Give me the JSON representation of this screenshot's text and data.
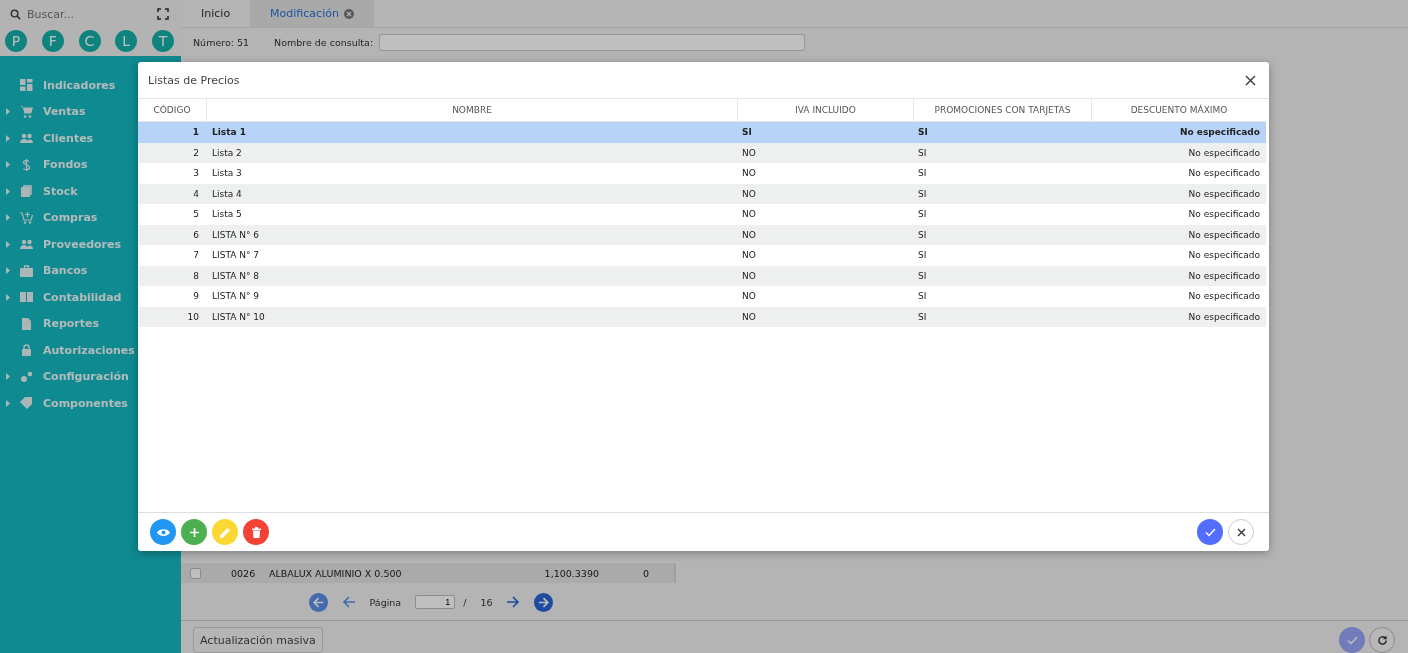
{
  "sidebar": {
    "search": {
      "placeholder": "Buscar..."
    },
    "shortcuts": [
      "P",
      "F",
      "C",
      "L",
      "T"
    ],
    "items": [
      {
        "label": "Indicadores",
        "expandable": false
      },
      {
        "label": "Ventas",
        "expandable": true
      },
      {
        "label": "Clientes",
        "expandable": true
      },
      {
        "label": "Fondos",
        "expandable": true
      },
      {
        "label": "Stock",
        "expandable": true
      },
      {
        "label": "Compras",
        "expandable": true
      },
      {
        "label": "Proveedores",
        "expandable": true
      },
      {
        "label": "Bancos",
        "expandable": true
      },
      {
        "label": "Contabilidad",
        "expandable": true
      },
      {
        "label": "Reportes",
        "expandable": false
      },
      {
        "label": "Autorizaciones",
        "expandable": false
      },
      {
        "label": "Configuración",
        "expandable": true
      },
      {
        "label": "Componentes",
        "expandable": true
      }
    ]
  },
  "tabs": [
    {
      "label": "Inicio",
      "selected": false,
      "closable": false
    },
    {
      "label": "Modificación",
      "selected": true,
      "closable": true
    }
  ],
  "form": {
    "number": "Número: 51",
    "query_label": "Nombre de consulta:"
  },
  "background_rows": [
    {
      "code": "0026",
      "name": "ALBALUX ALUMINIO X 0.500",
      "price": "1,100.3390",
      "qty": "0",
      "checked": false
    }
  ],
  "pagination": {
    "label": "Página",
    "page": "1",
    "separator": "/",
    "total": "16"
  },
  "bottom_bar": {
    "button": "Actualización masiva"
  },
  "dialog": {
    "title": "Listas de Precios",
    "columns": [
      "CÓDIGO",
      "NOMBRE",
      "IVA INCLUIDO",
      "PROMOCIONES CON TARJETAS",
      "DESCUENTO MÁXIMO"
    ],
    "rows": [
      {
        "code": "1",
        "name": "Lista 1",
        "iva": "SI",
        "promo": "SI",
        "discount": "No especificado",
        "selected": true
      },
      {
        "code": "2",
        "name": "Lista 2",
        "iva": "NO",
        "promo": "SI",
        "discount": "No especificado",
        "selected": false
      },
      {
        "code": "3",
        "name": "Lista 3",
        "iva": "NO",
        "promo": "SI",
        "discount": "No especificado",
        "selected": false
      },
      {
        "code": "4",
        "name": "Lista 4",
        "iva": "NO",
        "promo": "SI",
        "discount": "No especificado",
        "selected": false
      },
      {
        "code": "5",
        "name": "Lista 5",
        "iva": "NO",
        "promo": "SI",
        "discount": "No especificado",
        "selected": false
      },
      {
        "code": "6",
        "name": "LISTA N° 6",
        "iva": "NO",
        "promo": "SI",
        "discount": "No especificado",
        "selected": false
      },
      {
        "code": "7",
        "name": "LISTA N° 7",
        "iva": "NO",
        "promo": "SI",
        "discount": "No especificado",
        "selected": false
      },
      {
        "code": "8",
        "name": "LISTA N° 8",
        "iva": "NO",
        "promo": "SI",
        "discount": "No especificado",
        "selected": false
      },
      {
        "code": "9",
        "name": "LISTA N° 9",
        "iva": "NO",
        "promo": "SI",
        "discount": "No especificado",
        "selected": false
      },
      {
        "code": "10",
        "name": "LISTA N° 10",
        "iva": "NO",
        "promo": "SI",
        "discount": "No especificado",
        "selected": false
      }
    ]
  }
}
